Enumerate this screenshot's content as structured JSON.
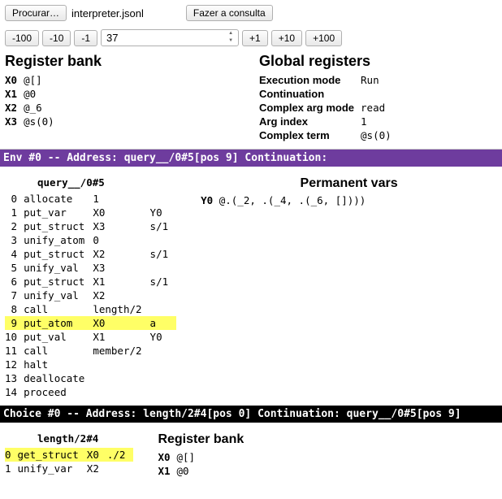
{
  "top": {
    "browse_label": "Procurar…",
    "filename": "interpreter.jsonl",
    "query_label": "Fazer a consulta"
  },
  "nav": {
    "m100": "-100",
    "m10": "-10",
    "m1": "-1",
    "value": "37",
    "p1": "+1",
    "p10": "+10",
    "p100": "+100"
  },
  "registers_title": "Register bank",
  "registers": [
    {
      "name": "X0",
      "val": "@[]"
    },
    {
      "name": "X1",
      "val": "@0"
    },
    {
      "name": "X2",
      "val": "@_6"
    },
    {
      "name": "X3",
      "val": "@s(0)"
    }
  ],
  "globals_title": "Global registers",
  "globals": [
    {
      "label": "Execution mode",
      "val": "Run"
    },
    {
      "label": "Continuation",
      "val": ""
    },
    {
      "label": "Complex arg mode",
      "val": "read"
    },
    {
      "label": "Arg index",
      "val": "1"
    },
    {
      "label": "Complex term",
      "val": "@s(0)"
    }
  ],
  "env_band": "Env #0 -- Address: query__/0#5[pos 9] Continuation:",
  "env": {
    "procname": "query__/0#5",
    "highlight": 9,
    "instr": [
      {
        "n": 0,
        "op": "allocate",
        "a1": "1",
        "a2": ""
      },
      {
        "n": 1,
        "op": "put_var",
        "a1": "X0",
        "a2": "Y0"
      },
      {
        "n": 2,
        "op": "put_struct",
        "a1": "X3",
        "a2": "s/1"
      },
      {
        "n": 3,
        "op": "unify_atom",
        "a1": "0",
        "a2": ""
      },
      {
        "n": 4,
        "op": "put_struct",
        "a1": "X2",
        "a2": "s/1"
      },
      {
        "n": 5,
        "op": "unify_val",
        "a1": "X3",
        "a2": ""
      },
      {
        "n": 6,
        "op": "put_struct",
        "a1": "X1",
        "a2": "s/1"
      },
      {
        "n": 7,
        "op": "unify_val",
        "a1": "X2",
        "a2": ""
      },
      {
        "n": 8,
        "op": "call",
        "a1": "length/2",
        "a2": ""
      },
      {
        "n": 9,
        "op": "put_atom",
        "a1": "X0",
        "a2": "a"
      },
      {
        "n": 10,
        "op": "put_val",
        "a1": "X1",
        "a2": "Y0"
      },
      {
        "n": 11,
        "op": "call",
        "a1": "member/2",
        "a2": ""
      },
      {
        "n": 12,
        "op": "halt",
        "a1": "",
        "a2": ""
      },
      {
        "n": 13,
        "op": "deallocate",
        "a1": "",
        "a2": ""
      },
      {
        "n": 14,
        "op": "proceed",
        "a1": "",
        "a2": ""
      }
    ],
    "perm_title": "Permanent vars",
    "perm": [
      {
        "name": "Y0",
        "val": "@.(_2, .(_4, .(_6, [])))"
      }
    ]
  },
  "choice_band": "Choice #0 -- Address: length/2#4[pos 0] Continuation: query__/0#5[pos 9]",
  "choice": {
    "procname": "length/2#4",
    "highlight": 0,
    "instr": [
      {
        "n": 0,
        "op": "get_struct",
        "a1": "X0",
        "a2": "./2"
      },
      {
        "n": 1,
        "op": "unify_var",
        "a1": "X2",
        "a2": ""
      }
    ],
    "reg_title": "Register bank",
    "registers": [
      {
        "name": "X0",
        "val": "@[]"
      },
      {
        "name": "X1",
        "val": "@0"
      }
    ]
  }
}
